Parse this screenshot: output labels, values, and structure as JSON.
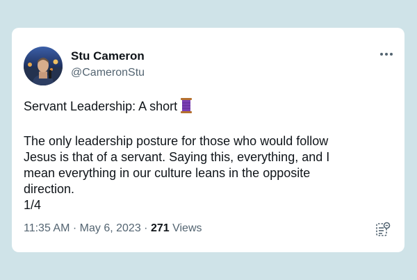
{
  "tweet": {
    "author": {
      "display_name": "Stu Cameron",
      "handle": "@CameronStu"
    },
    "text_lines": [
      "Servant Leadership: A short",
      "",
      "The only leadership posture for those who would follow",
      "Jesus is that of a servant. Saying this, everything, and I",
      "mean everything in our culture leans in the opposite",
      "direction.",
      "1/4"
    ],
    "thread_emoji": "spool-of-thread-icon",
    "time": "11:35 AM",
    "separator": "·",
    "date": "May 6, 2023",
    "views_count": "271",
    "views_label": "Views",
    "more_icon": "more-horizontal-icon",
    "summary_icon": "thread-summary-icon"
  },
  "colors": {
    "background": "#cfe3e8",
    "card": "#ffffff",
    "primary_text": "#0f1419",
    "secondary_text": "#536471",
    "spool": "#7b3fb5"
  }
}
